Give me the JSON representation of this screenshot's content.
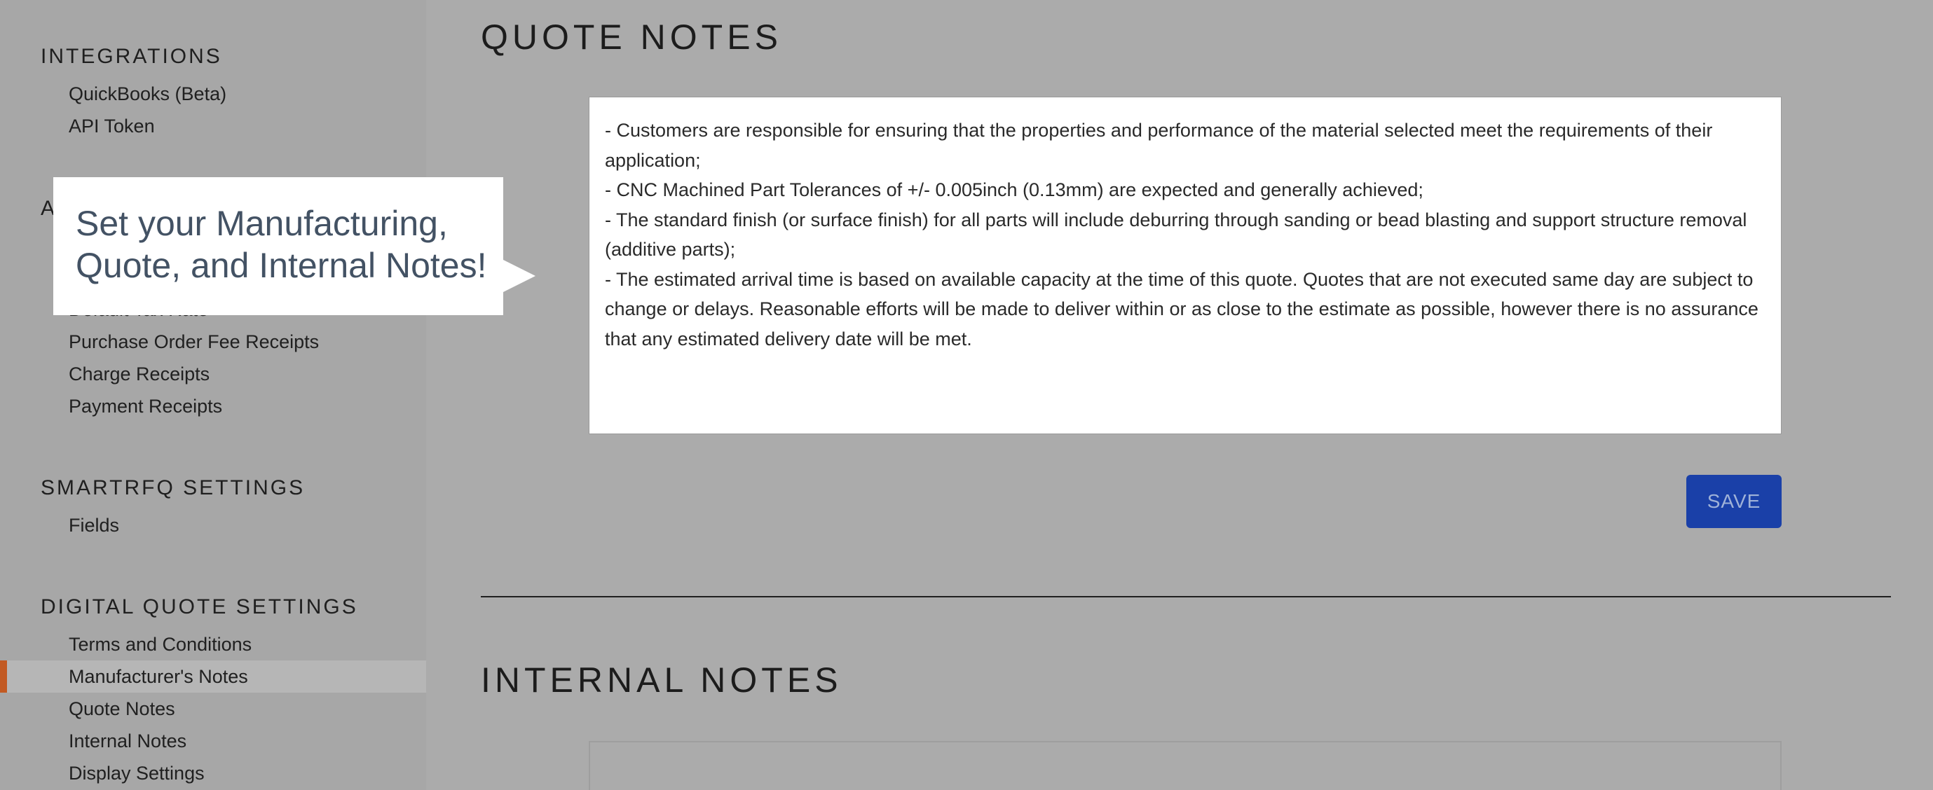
{
  "sidebar": {
    "sections": [
      {
        "heading": "INTEGRATIONS",
        "items": [
          "QuickBooks (Beta)",
          "API Token"
        ]
      },
      {
        "heading": "A",
        "items": [
          "Default Tax Rate",
          "Purchase Order Fee Receipts",
          "Charge Receipts",
          "Payment Receipts"
        ]
      },
      {
        "heading": "SMARTRFQ SETTINGS",
        "items": [
          "Fields"
        ]
      },
      {
        "heading": "DIGITAL QUOTE SETTINGS",
        "items": [
          "Terms and Conditions",
          "Manufacturer's Notes",
          "Quote Notes",
          "Internal Notes",
          "Display Settings"
        ]
      }
    ],
    "active_item": "Manufacturer's Notes"
  },
  "main": {
    "quote_notes": {
      "heading": "QUOTE NOTES",
      "lines": [
        "- Customers are responsible for ensuring that the properties and performance of the material selected meet the requirements of their application;",
        "- CNC Machined Part Tolerances of +/- 0.005inch (0.13mm) are expected and generally achieved;",
        "- The standard finish (or surface finish) for all parts will include deburring through sanding or bead blasting and support structure removal (additive parts);",
        "- The estimated arrival time is based on available capacity at the time of this quote. Quotes that are not executed same day are subject to change or delays. Reasonable efforts will be made to deliver within or as close to the estimate as possible, however there is no assurance that any estimated delivery date will be met."
      ],
      "save_label": "SAVE"
    },
    "internal_notes": {
      "heading": "INTERNAL NOTES"
    }
  },
  "callout": {
    "text": "Set your Manufacturing, Quote, and Internal Notes!"
  },
  "colors": {
    "overlay_background": "#ababab",
    "active_marker": "#c25a23",
    "save_button": "#1a40a8",
    "callout_text": "#435264"
  }
}
